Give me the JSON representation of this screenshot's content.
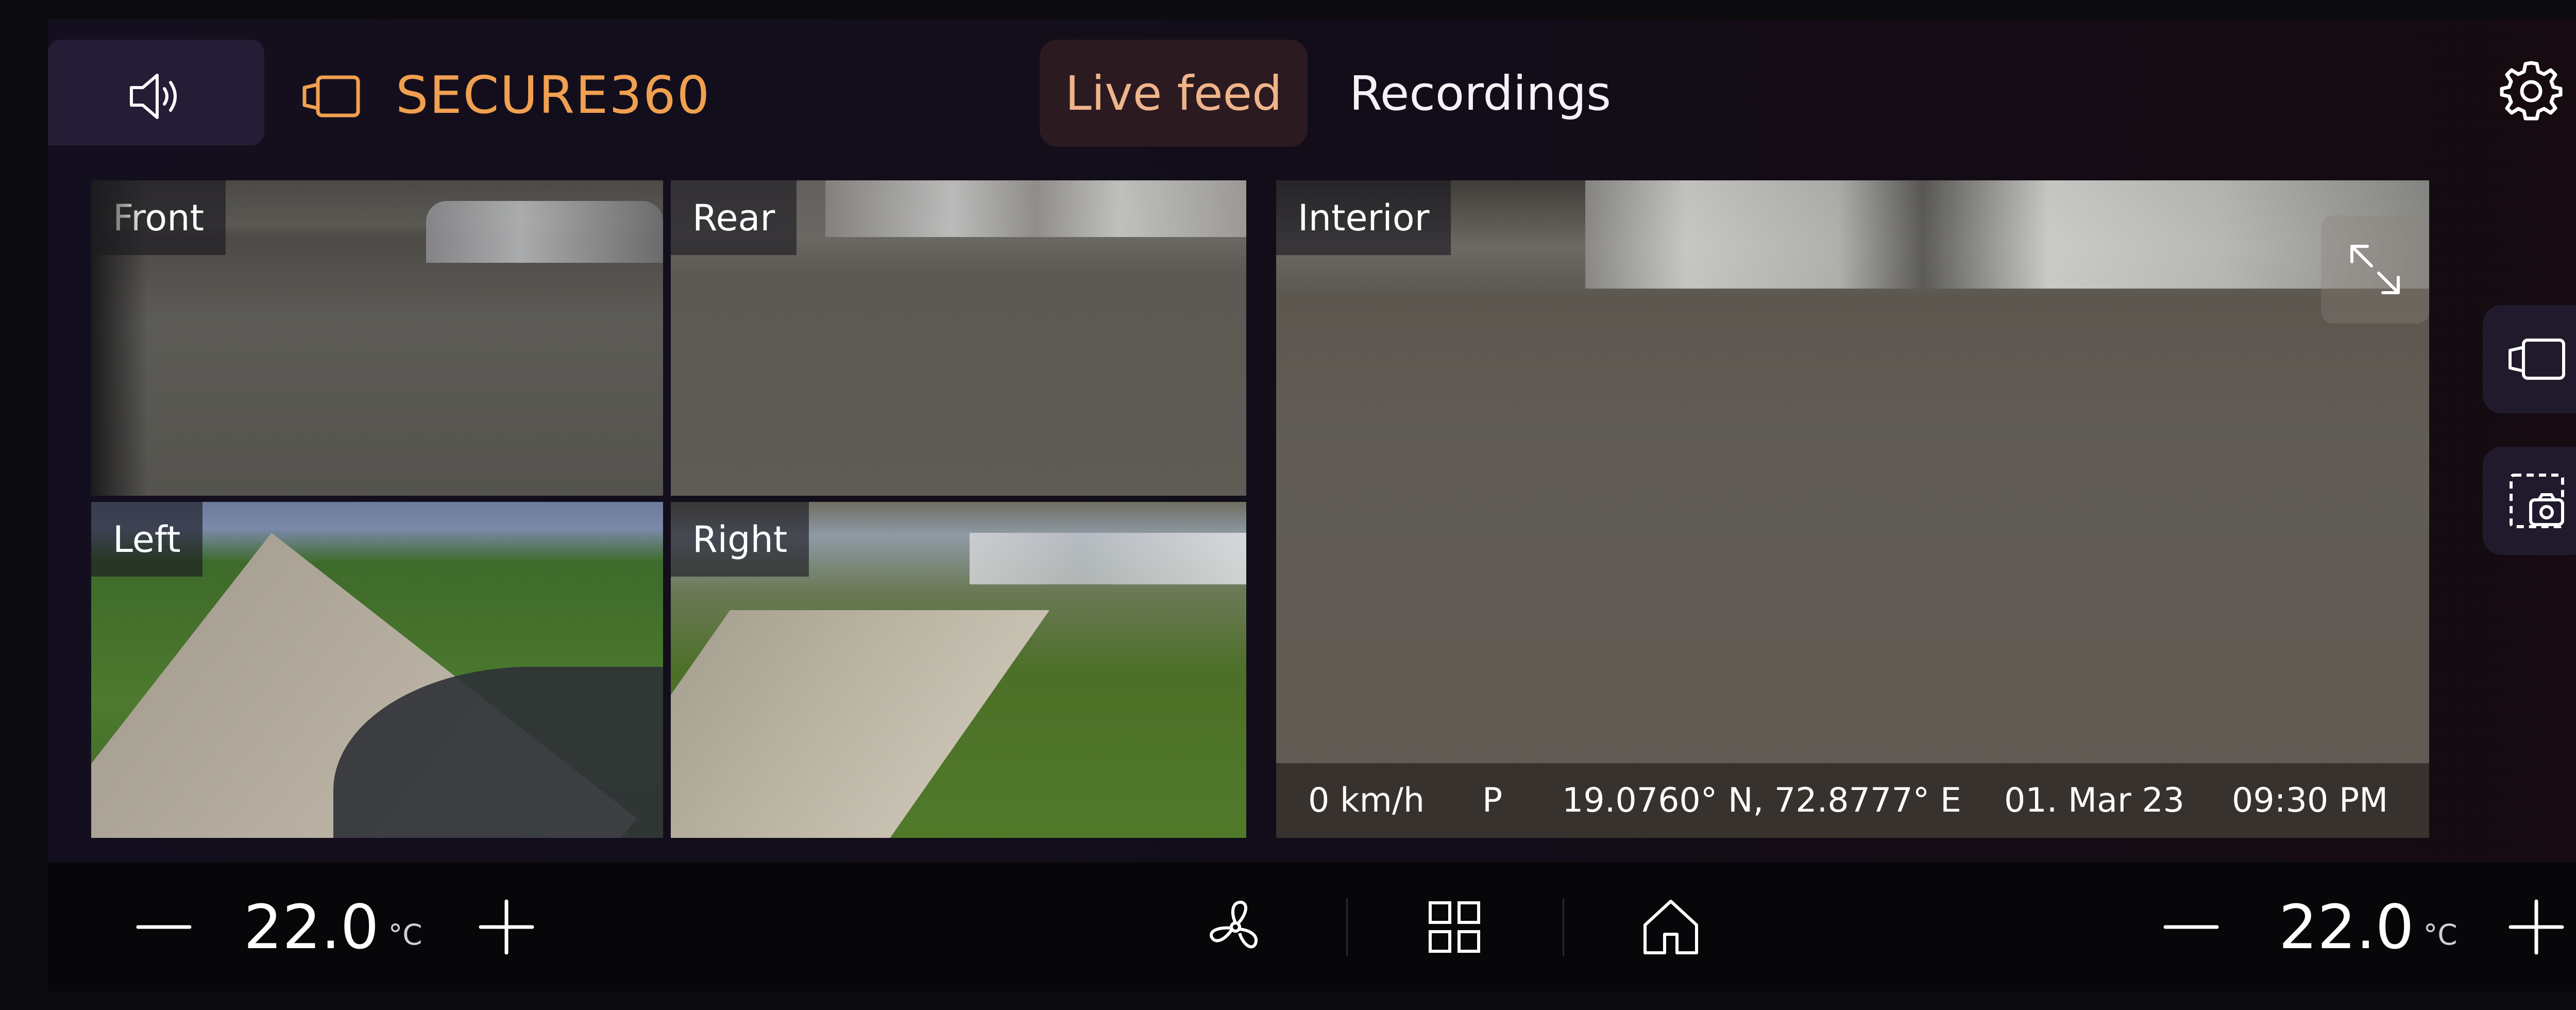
{
  "header": {
    "brand": "SECURE360",
    "tabs": [
      {
        "label": "Live feed",
        "active": true
      },
      {
        "label": "Recordings",
        "active": false
      }
    ]
  },
  "cameras": {
    "front": "Front",
    "rear": "Rear",
    "left": "Left",
    "right": "Right",
    "interior": "Interior"
  },
  "status": {
    "speed": "0 km/h",
    "gear": "P",
    "coordinates": "19.0760° N, 72.8777° E",
    "date": "01. Mar 23",
    "time": "09:30 PM"
  },
  "climate": {
    "left": {
      "value": "22.0",
      "unit": "°C"
    },
    "right": {
      "value": "22.0",
      "unit": "°C"
    }
  },
  "colors": {
    "brand": "#f0a050",
    "active_tab_bg": "#2b1a20",
    "active_tab_text": "#efb48a",
    "panel_bg": "#140f1e"
  },
  "icons": {
    "volume": "volume-icon",
    "brand_logo": "camera-outline-icon",
    "settings": "gear-icon",
    "expand": "expand-icon",
    "camera_view": "camera-view-icon",
    "snapshot": "screenshot-icon",
    "fan": "fan-icon",
    "grid": "grid-icon",
    "home": "home-icon",
    "minus": "minus-icon",
    "plus": "plus-icon"
  }
}
